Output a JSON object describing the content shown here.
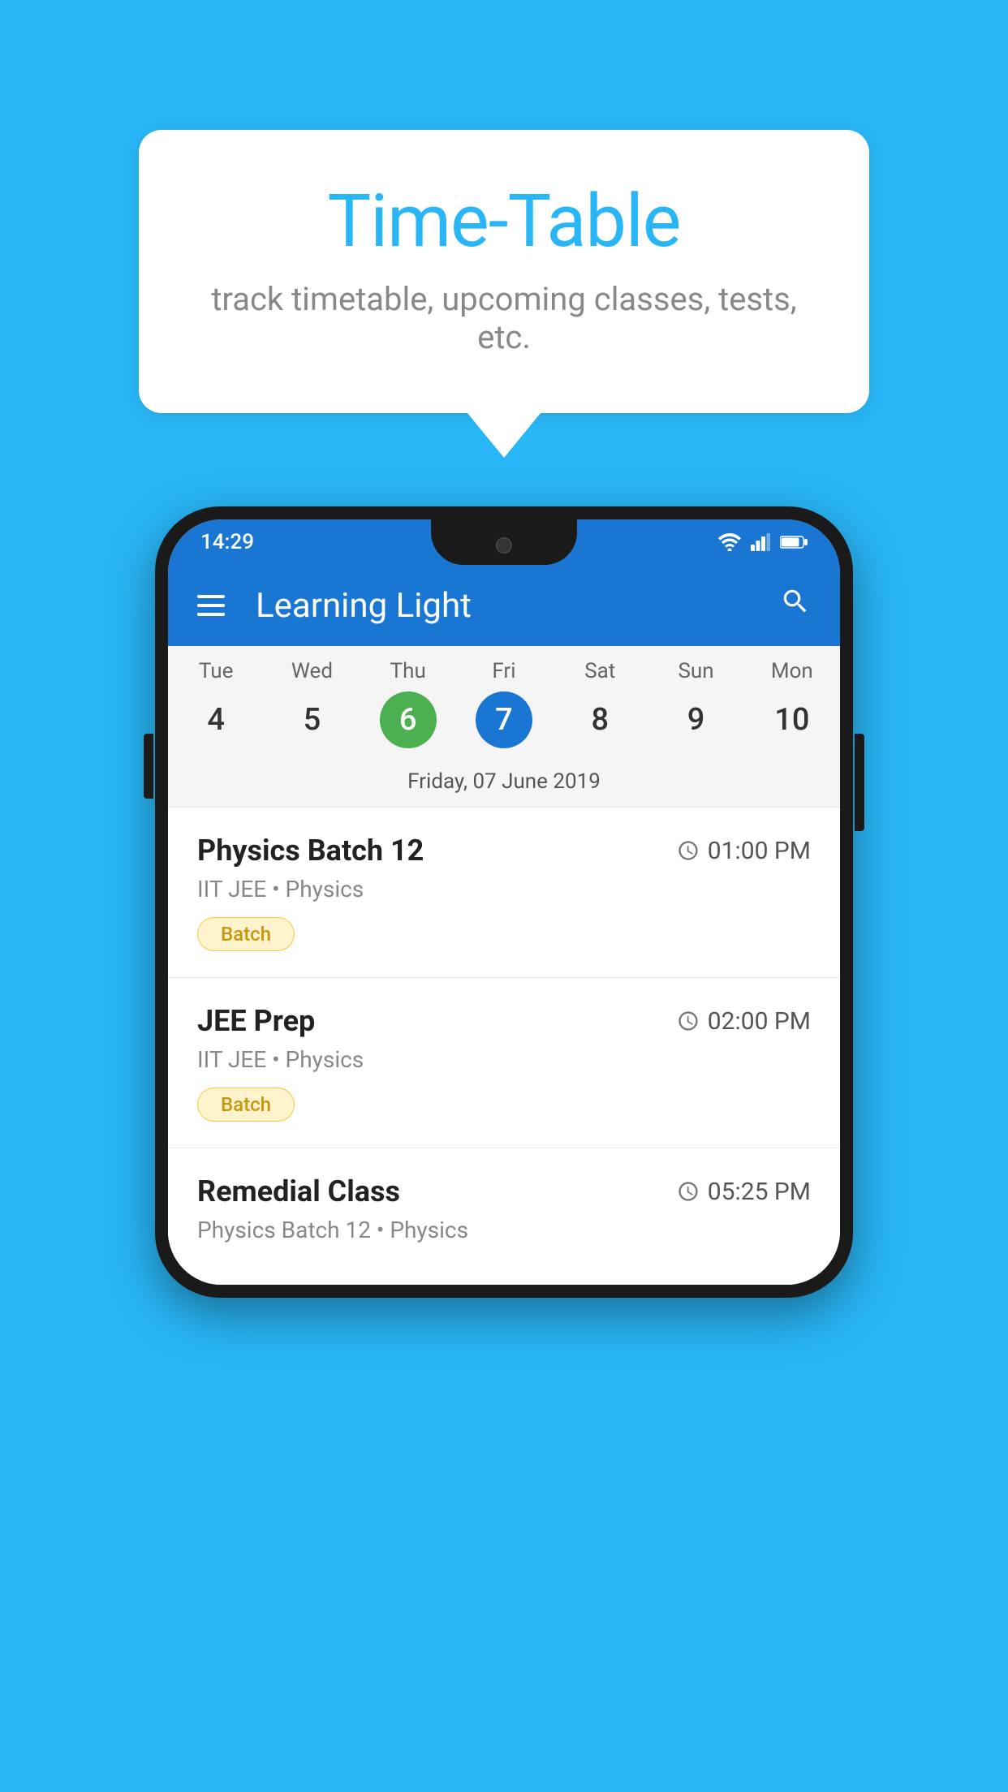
{
  "background_color": "#29B6F6",
  "speech_bubble": {
    "title": "Time-Table",
    "subtitle": "track timetable, upcoming classes, tests, etc."
  },
  "phone": {
    "status_bar": {
      "time": "14:29"
    },
    "app_bar": {
      "title": "Learning Light"
    },
    "calendar": {
      "days": [
        {
          "name": "Tue",
          "number": "4",
          "state": "normal"
        },
        {
          "name": "Wed",
          "number": "5",
          "state": "normal"
        },
        {
          "name": "Thu",
          "number": "6",
          "state": "today"
        },
        {
          "name": "Fri",
          "number": "7",
          "state": "selected"
        },
        {
          "name": "Sat",
          "number": "8",
          "state": "normal"
        },
        {
          "name": "Sun",
          "number": "9",
          "state": "normal"
        },
        {
          "name": "Mon",
          "number": "10",
          "state": "normal"
        }
      ],
      "selected_date_label": "Friday, 07 June 2019"
    },
    "schedule": [
      {
        "name": "Physics Batch 12",
        "time": "01:00 PM",
        "meta": "IIT JEE • Physics",
        "badge": "Batch"
      },
      {
        "name": "JEE Prep",
        "time": "02:00 PM",
        "meta": "IIT JEE • Physics",
        "badge": "Batch"
      },
      {
        "name": "Remedial Class",
        "time": "05:25 PM",
        "meta": "Physics Batch 12 • Physics",
        "badge": null
      }
    ]
  },
  "icons": {
    "hamburger": "☰",
    "search": "🔍",
    "clock": "🕐"
  }
}
